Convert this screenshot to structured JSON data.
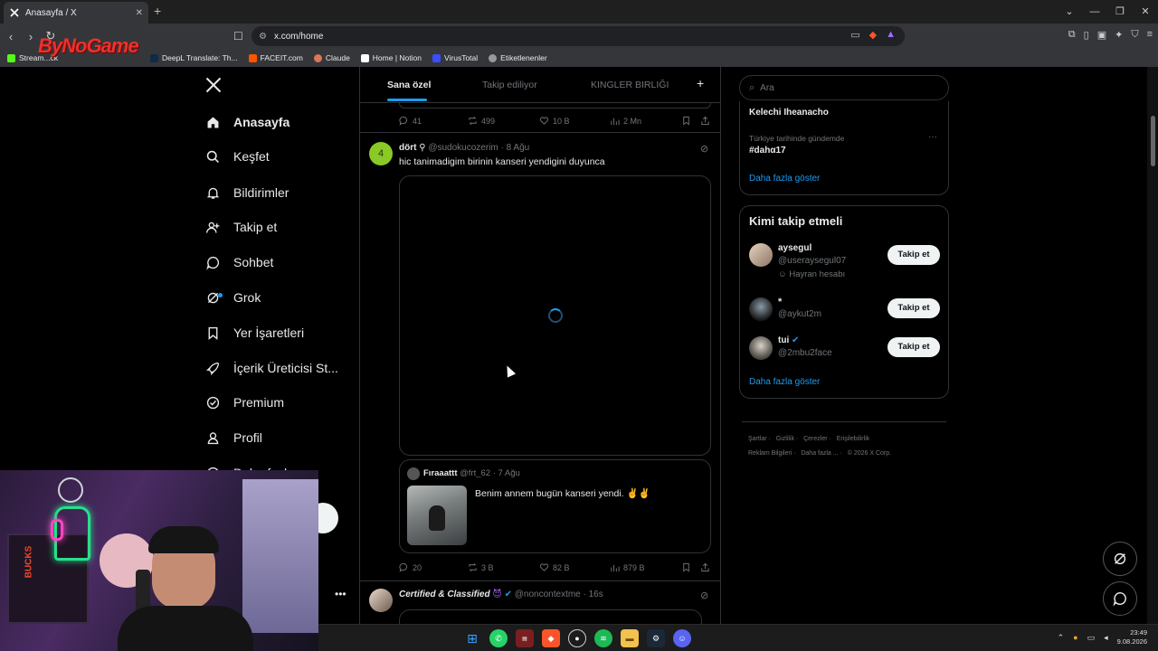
{
  "browser": {
    "tab_title": "Anasayfa / X",
    "url": "x.com/home",
    "bookmarks": [
      "Stream...ck",
      "DeepL Translate: Th...",
      "FACEIT.com",
      "Claude",
      "Home | Notion",
      "VirusTotal",
      "Etiketlenenler"
    ],
    "watermark": "ByNoGame"
  },
  "sidebar": {
    "logo": "X",
    "items": [
      {
        "label": "Anasayfa",
        "icon": "home-icon"
      },
      {
        "label": "Keşfet",
        "icon": "search-icon"
      },
      {
        "label": "Bildirimler",
        "icon": "bell-icon"
      },
      {
        "label": "Takip et",
        "icon": "add-user-icon"
      },
      {
        "label": "Sohbet",
        "icon": "chat-icon"
      },
      {
        "label": "Grok",
        "icon": "grok-icon"
      },
      {
        "label": "Yer İşaretleri",
        "icon": "bookmark-icon"
      },
      {
        "label": "İçerik Üreticisi St...",
        "icon": "rocket-icon"
      },
      {
        "label": "Premium",
        "icon": "verified-icon"
      },
      {
        "label": "Profil",
        "icon": "profile-icon"
      },
      {
        "label": "Daha fazla",
        "icon": "more-icon"
      }
    ]
  },
  "feed": {
    "tabs": [
      "Sana özel",
      "Takip ediliyor",
      "KINGLER BIRLIĞI"
    ],
    "prev_actions": {
      "replies": "41",
      "reposts": "499",
      "likes": "10 B",
      "views": "2 Mn"
    },
    "post": {
      "name": "dört",
      "handle": "@sudokucozerim",
      "time": "8 Ağu",
      "avatar_text": "4",
      "text": "hic tanimadigim birinin kanseri yendigini duyunca",
      "quote": {
        "name": "Fıraaattt",
        "handle": "@frt_62",
        "time": "7 Ağu",
        "text": "Benim annem bugün kanseri yendi. ✌️✌️"
      },
      "actions": {
        "replies": "20",
        "reposts": "3 B",
        "likes": "82 B",
        "views": "879 B"
      }
    },
    "next_post": {
      "name": "Certified & Classified",
      "handle": "@noncontextme",
      "time": "16s"
    }
  },
  "right": {
    "search_placeholder": "Ara",
    "trends": [
      {
        "title": "Kelechi Iheanacho"
      },
      {
        "context": "Türkiye tarihinde gündemde",
        "title": "#dahα17"
      }
    ],
    "trends_more": "Daha fazla göster",
    "who_title": "Kimi takip etmeli",
    "who": [
      {
        "name": "aysegul",
        "handle": "@useraysegul07",
        "note": "Hayran hesabı",
        "verified": false
      },
      {
        "name": "*",
        "handle": "@aykut2m",
        "verified": false
      },
      {
        "name": "tui",
        "handle": "@2mbu2face",
        "verified": true
      }
    ],
    "follow_label": "Takip et",
    "who_more": "Daha fazla göster",
    "footer": [
      "Şartlar",
      "Gizlilik",
      "Çerezler",
      "Erişilebilirlik",
      "Reklam Bilgileri",
      "Daha fazla ...",
      "© 2026 X Corp."
    ]
  },
  "taskbar": {
    "time": "23:49",
    "date": "9.08.2026"
  },
  "colors": {
    "accent": "#1d9bf0",
    "background": "#000000",
    "border": "#2f3336",
    "muted": "#71767b"
  }
}
